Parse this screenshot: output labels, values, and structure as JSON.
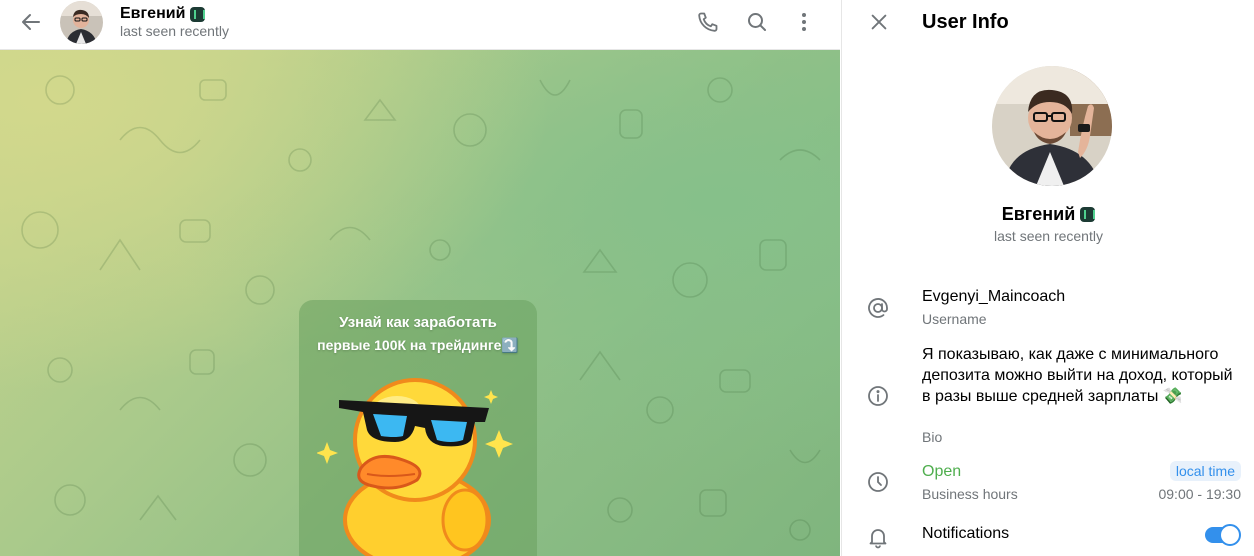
{
  "chat_header": {
    "name": "Евгений",
    "status": "last seen recently",
    "icons": [
      "back-arrow-icon",
      "phone-icon",
      "search-icon",
      "more-vertical-icon"
    ]
  },
  "message": {
    "line1": "Узнай как заработать",
    "line2": "первые 100К на трейдинге⤵️"
  },
  "info_panel": {
    "title": "User Info",
    "name": "Евгений",
    "status": "last seen recently",
    "username": "Evgenyi_Maincoach",
    "username_label": "Username",
    "bio": "Я показываю, как даже с минимального депозита можно выйти на доход, который в разы выше средней зарплаты 💸",
    "bio_label": "Bio",
    "hours_status": "Open",
    "hours_label": "Business hours",
    "local_time_label": "local time",
    "hours_range": "09:00 - 19:30",
    "notifications_label": "Notifications",
    "notifications_enabled": true
  },
  "colors": {
    "accent": "#3390ec",
    "open_green": "#4fae4e",
    "secondary_text": "#707579"
  }
}
